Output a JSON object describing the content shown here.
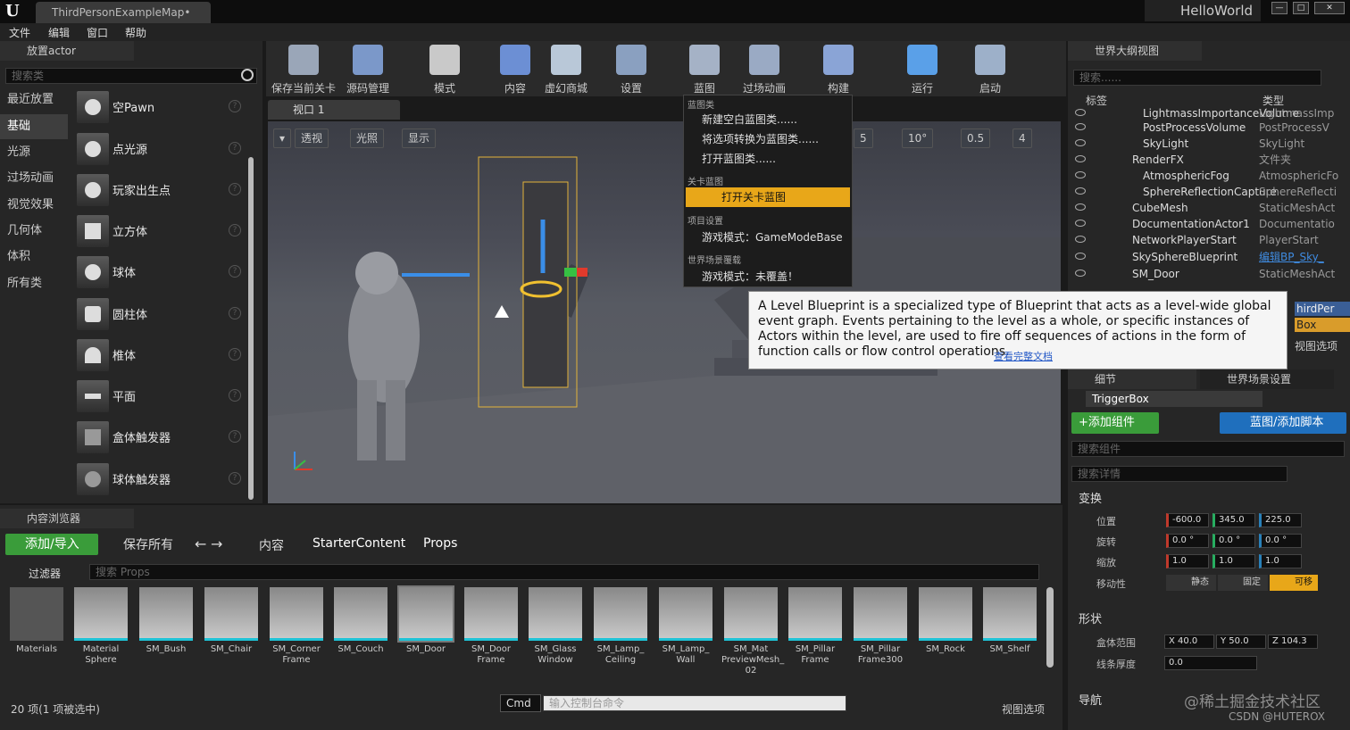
{
  "titlebar": {
    "tab": "ThirdPersonExampleMap•",
    "project": "HelloWorld",
    "min": "—",
    "max": "□",
    "close": "✕"
  },
  "menu": [
    "文件",
    "编辑",
    "窗口",
    "帮助"
  ],
  "place_actor": {
    "title": "放置actor",
    "search_placeholder": "搜索类",
    "categories": [
      "最近放置",
      "基础",
      "光源",
      "过场动画",
      "视觉效果",
      "几何体",
      "体积",
      "所有类"
    ],
    "items": [
      "空Pawn",
      "点光源",
      "玩家出生点",
      "立方体",
      "球体",
      "圆柱体",
      "椎体",
      "平面",
      "盒体触发器",
      "球体触发器"
    ]
  },
  "toolbar": [
    {
      "label": "保存当前关卡",
      "color": "#9aa6b8"
    },
    {
      "label": "源码管理",
      "color": "#7b98c9"
    },
    {
      "label": "模式",
      "color": "#c9c9c9"
    },
    {
      "label": "内容",
      "color": "#6c8fd4"
    },
    {
      "label": "虚幻商城",
      "color": "#b9c8d8"
    },
    {
      "label": "设置",
      "color": "#8aa0c0"
    },
    {
      "label": "蓝图",
      "color": "#a5b2c6"
    },
    {
      "label": "过场动画",
      "color": "#9aaac4"
    },
    {
      "label": "构建",
      "color": "#8aa4d6"
    },
    {
      "label": "运行",
      "color": "#5aa0e8"
    },
    {
      "label": "启动",
      "color": "#9db0c9"
    }
  ],
  "viewport": {
    "tab": "视口 1",
    "buttons": [
      "透视",
      "光照",
      "显示"
    ],
    "right_values": [
      "5",
      "10°",
      "0.5",
      "4"
    ]
  },
  "blueprint_menu": {
    "sec1": "蓝图类",
    "new_blank": "新建空白蓝图类......",
    "convert": "将选项转换为蓝图类......",
    "open_class": "打开蓝图类......",
    "sec2": "关卡蓝图",
    "open_level": "打开关卡蓝图",
    "sec3": "项目设置",
    "gamemode": "游戏模式：GameModeBase",
    "sec4": "世界场景覆载",
    "override": "游戏模式：未覆盖！"
  },
  "tooltip": {
    "text": "A Level Blueprint is a specialized type of Blueprint that acts as a level-wide global event graph. Events pertaining to the level as a whole, or specific instances of Actors within the level, are used to fire off sequences of actions in the form of function calls or flow control operations.",
    "link": "查看完整文档"
  },
  "outliner": {
    "title": "世界大纲视图",
    "search_placeholder": "搜索......",
    "col_label": "标签",
    "col_type": "类型",
    "rows": [
      {
        "name": "LightmassImportanceVolume",
        "type": "LightmassImp"
      },
      {
        "name": "PostProcessVolume",
        "type": "PostProcessV"
      },
      {
        "name": "SkyLight",
        "type": "SkyLight"
      },
      {
        "name": "RenderFX",
        "type": "文件夹"
      },
      {
        "name": "AtmosphericFog",
        "type": "AtmosphericFo"
      },
      {
        "name": "SphereReflectionCapture",
        "type": "SphereReflecti"
      },
      {
        "name": "CubeMesh",
        "type": "StaticMeshAct"
      },
      {
        "name": "DocumentationActor1",
        "type": "Documentatio"
      },
      {
        "name": "NetworkPlayerStart",
        "type": "PlayerStart"
      },
      {
        "name": "SkySphereBlueprint",
        "type": "编辑BP_Sky_"
      },
      {
        "name": "SM_Door",
        "type": "StaticMeshAct"
      }
    ],
    "partial_right": [
      "hirdPer",
      "Box",
      "视图选项"
    ]
  },
  "details": {
    "tab_details": "细节",
    "tab_world": "世界场景设置",
    "object_name": "TriggerBox",
    "add_component": "+添加组件",
    "blueprint_btn": "蓝图/添加脚本",
    "search_components": "搜索组件",
    "search_details": "搜索详情",
    "sec_transform": "变换",
    "location": "位置",
    "rotation": "旋转",
    "scale": "缩放",
    "mobility": "移动性",
    "loc": [
      "-600.0",
      "345.0",
      "225.0"
    ],
    "rot": [
      "0.0 °",
      "0.0 °",
      "0.0 °"
    ],
    "scl": [
      "1.0",
      "1.0",
      "1.0"
    ],
    "mob": [
      "静态",
      "固定",
      "可移"
    ],
    "sec_shape": "形状",
    "box_extent": "盒体范围",
    "extent": [
      "X  40.0",
      "Y  50.0",
      "Z  104.3"
    ],
    "line_thickness": "线条厚度",
    "line_val": "0.0",
    "sec_nav": "导航"
  },
  "content_browser": {
    "tab": "内容浏览器",
    "add_import": "添加/导入",
    "save_all": "保存所有",
    "path": [
      "内容",
      "StarterContent",
      "Props"
    ],
    "filter": "过滤器",
    "search_placeholder": "搜索 Props",
    "assets": [
      "Materials",
      "Material Sphere",
      "SM_Bush",
      "SM_Chair",
      "SM_Corner Frame",
      "SM_Couch",
      "SM_Door",
      "SM_Door Frame",
      "SM_Glass Window",
      "SM_Lamp_ Ceiling",
      "SM_Lamp_ Wall",
      "SM_Mat PreviewMesh_ 02",
      "SM_Pillar Frame",
      "SM_Pillar Frame300",
      "SM_Rock",
      "SM_Shelf"
    ],
    "status": "20 项(1 项被选中)",
    "cmd": "Cmd",
    "console_placeholder": "输入控制台命令",
    "view_options": "视图选项"
  },
  "watermark": "@稀土掘金技术社区",
  "watermark2": "CSDN @HUTEROX"
}
